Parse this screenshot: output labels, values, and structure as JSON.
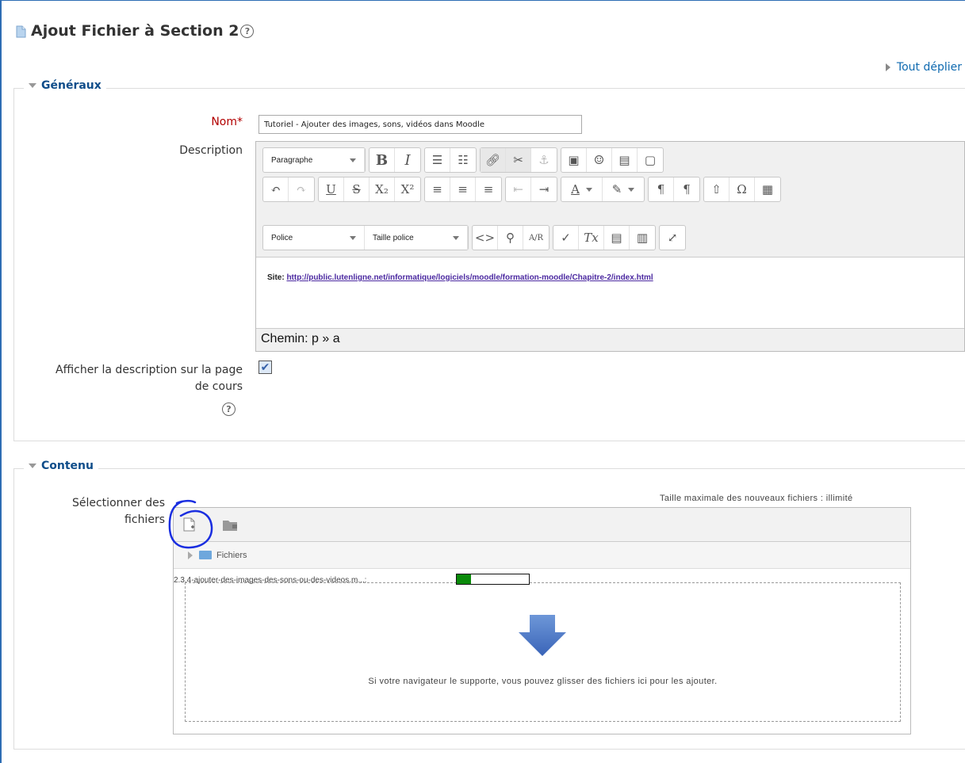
{
  "page": {
    "title": "Ajout Fichier à Section 2",
    "expand_all": "Tout déplier"
  },
  "general": {
    "legend": "Généraux",
    "name_label": "Nom",
    "name_required_mark": "*",
    "name_value": "Tutoriel - Ajouter des images, sons, vidéos dans Moodle",
    "description_label": "Description",
    "show_description_label_1": "Afficher la description sur la page",
    "show_description_label_2": "de cours",
    "show_description_checked": true
  },
  "editor": {
    "format_select": "Paragraphe",
    "font_select": "Police",
    "size_select": "Taille police",
    "content_prefix": "Site:",
    "content_link": "http://public.lutenligne.net/informatique/logiciels/moodle/formation-moodle/Chapitre-2/index.html",
    "path_label": "Chemin: p » a"
  },
  "content": {
    "legend": "Contenu",
    "select_files_label_1": "Sélectionner des",
    "select_files_label_2": "fichiers",
    "max_size": "Taille maximale des nouveaux fichiers : illimité",
    "folder_path": "Fichiers",
    "uploading_file": "2.3.4-ajouter-des-images-des-sons-ou-des-videos.m...:",
    "upload_progress": 0.2,
    "drop_message": "Si votre navigateur le supporte, vous pouvez glisser des fichiers ici pour les ajouter."
  },
  "colors": {
    "legend": "#0f4d8a",
    "link": "#0f6ab0",
    "required": "#b20000",
    "progress": "#0a8a0a",
    "annotation": "#1a2ee0"
  }
}
